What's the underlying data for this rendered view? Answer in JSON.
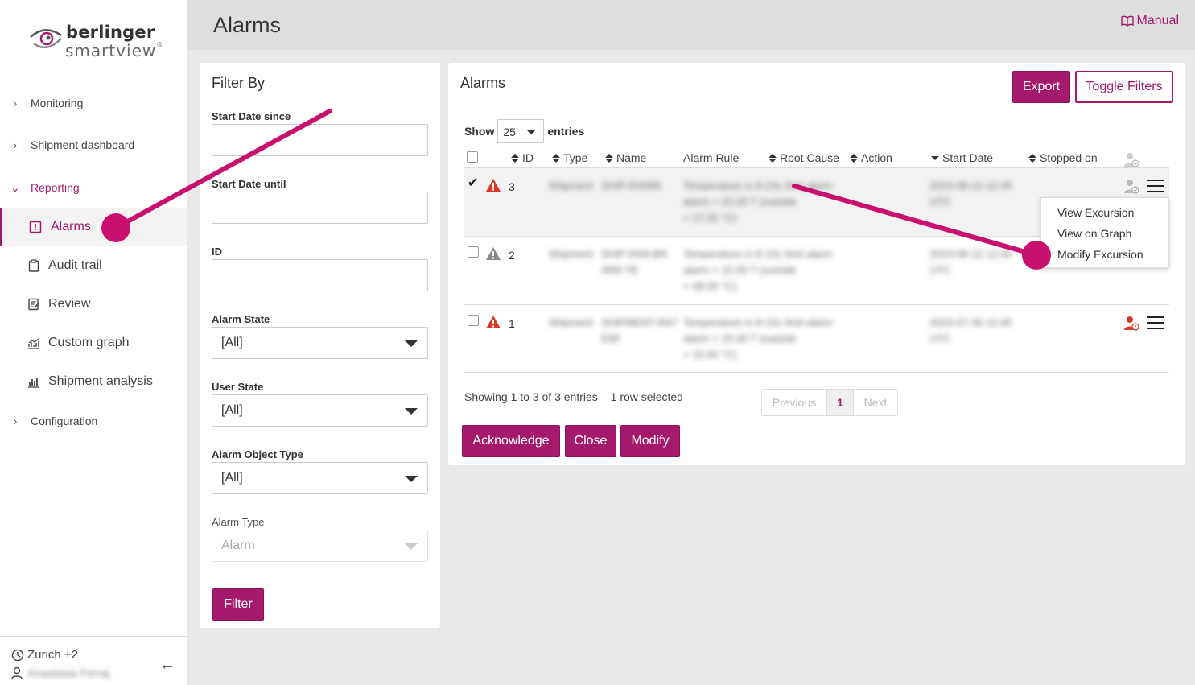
{
  "app": {
    "logo_line1": "berlinger",
    "logo_line2": "smartview",
    "logo_mark": "®",
    "brand_color": "#a4196b"
  },
  "sidebar": {
    "groups": [
      {
        "label": "Monitoring",
        "icon": "chevron-right-icon"
      },
      {
        "label": "Shipment dashboard",
        "icon": "chevron-right-icon"
      },
      {
        "label": "Reporting",
        "icon": "chevron-down-icon"
      },
      {
        "label": "Configuration",
        "icon": "chevron-right-icon"
      }
    ],
    "items": [
      {
        "label": "Alarms",
        "icon": "alarm-icon",
        "active": true
      },
      {
        "label": "Audit trail",
        "icon": "clipboard-icon"
      },
      {
        "label": "Review",
        "icon": "review-icon"
      },
      {
        "label": "Custom graph",
        "icon": "graph-icon"
      },
      {
        "label": "Shipment analysis",
        "icon": "bar-chart-icon"
      }
    ],
    "footer": {
      "timezone": "Zurich +2",
      "user": "Anastasia Ferraj"
    }
  },
  "header": {
    "title": "Alarms",
    "manual_label": "Manual"
  },
  "filter": {
    "title": "Filter By",
    "start_since_label": "Start Date since",
    "start_until_label": "Start Date until",
    "id_label": "ID",
    "alarm_state_label": "Alarm State",
    "alarm_state_value": "[All]",
    "user_state_label": "User State",
    "user_state_value": "[All]",
    "object_type_label": "Alarm Object Type",
    "object_type_value": "[All]",
    "alarm_type_label": "Alarm Type",
    "alarm_type_value": "Alarm",
    "filter_button": "Filter"
  },
  "alarms": {
    "title": "Alarms",
    "export_button": "Export",
    "toggle_button": "Toggle Filters",
    "show_label": "Show",
    "page_length": "25",
    "entries_label": "entries",
    "columns": [
      "ID",
      "Type",
      "Name",
      "Alarm Rule",
      "Root Cause",
      "Action",
      "Start Date",
      "Stopped on"
    ],
    "rows": [
      {
        "id": "3",
        "type": "Shipment",
        "name": "SHIP-RA995",
        "rule1": "Temperature in 8-15c limit alarm",
        "rule2": "alarm > 15.00 T (outside",
        "rule3": "> 17.00 °C)",
        "start1": "2023-08-10 12:45",
        "start2": "UTC",
        "severity": "warning-red",
        "selected": true
      },
      {
        "id": "2",
        "type": "Shipment",
        "name": "SHIP-RA9-BR",
        "name2": "AR9-TE",
        "rule1": "Temperature in 8-15c limit alarm",
        "rule2": "alarm > 15.00 T (outside",
        "rule3": "> 08.00 °C)",
        "start1": "2023-08-10 12:45",
        "start2": "UTC",
        "severity": "warning-grey",
        "selected": false
      },
      {
        "id": "1",
        "type": "Shipment",
        "name": "SHIPMENT-RA7",
        "name2": "E99",
        "rule1": "Temperature in 8-15c limit alarm",
        "rule2": "alarm > 15.00 T (outside",
        "rule3": "> 15.00 °C)",
        "start1": "2023-07-30 12:45",
        "start2": "UTC",
        "severity": "warning-red",
        "selected": false
      }
    ],
    "info": "Showing 1 to 3 of 3 entries",
    "selection_info": "1 row selected",
    "prev_label": "Previous",
    "current_page": "1",
    "next_label": "Next",
    "acknowledge_button": "Acknowledge",
    "close_button": "Close",
    "modify_button": "Modify"
  },
  "context_menu": {
    "items": [
      "View Excursion",
      "View on Graph",
      "Modify Excursion"
    ]
  }
}
